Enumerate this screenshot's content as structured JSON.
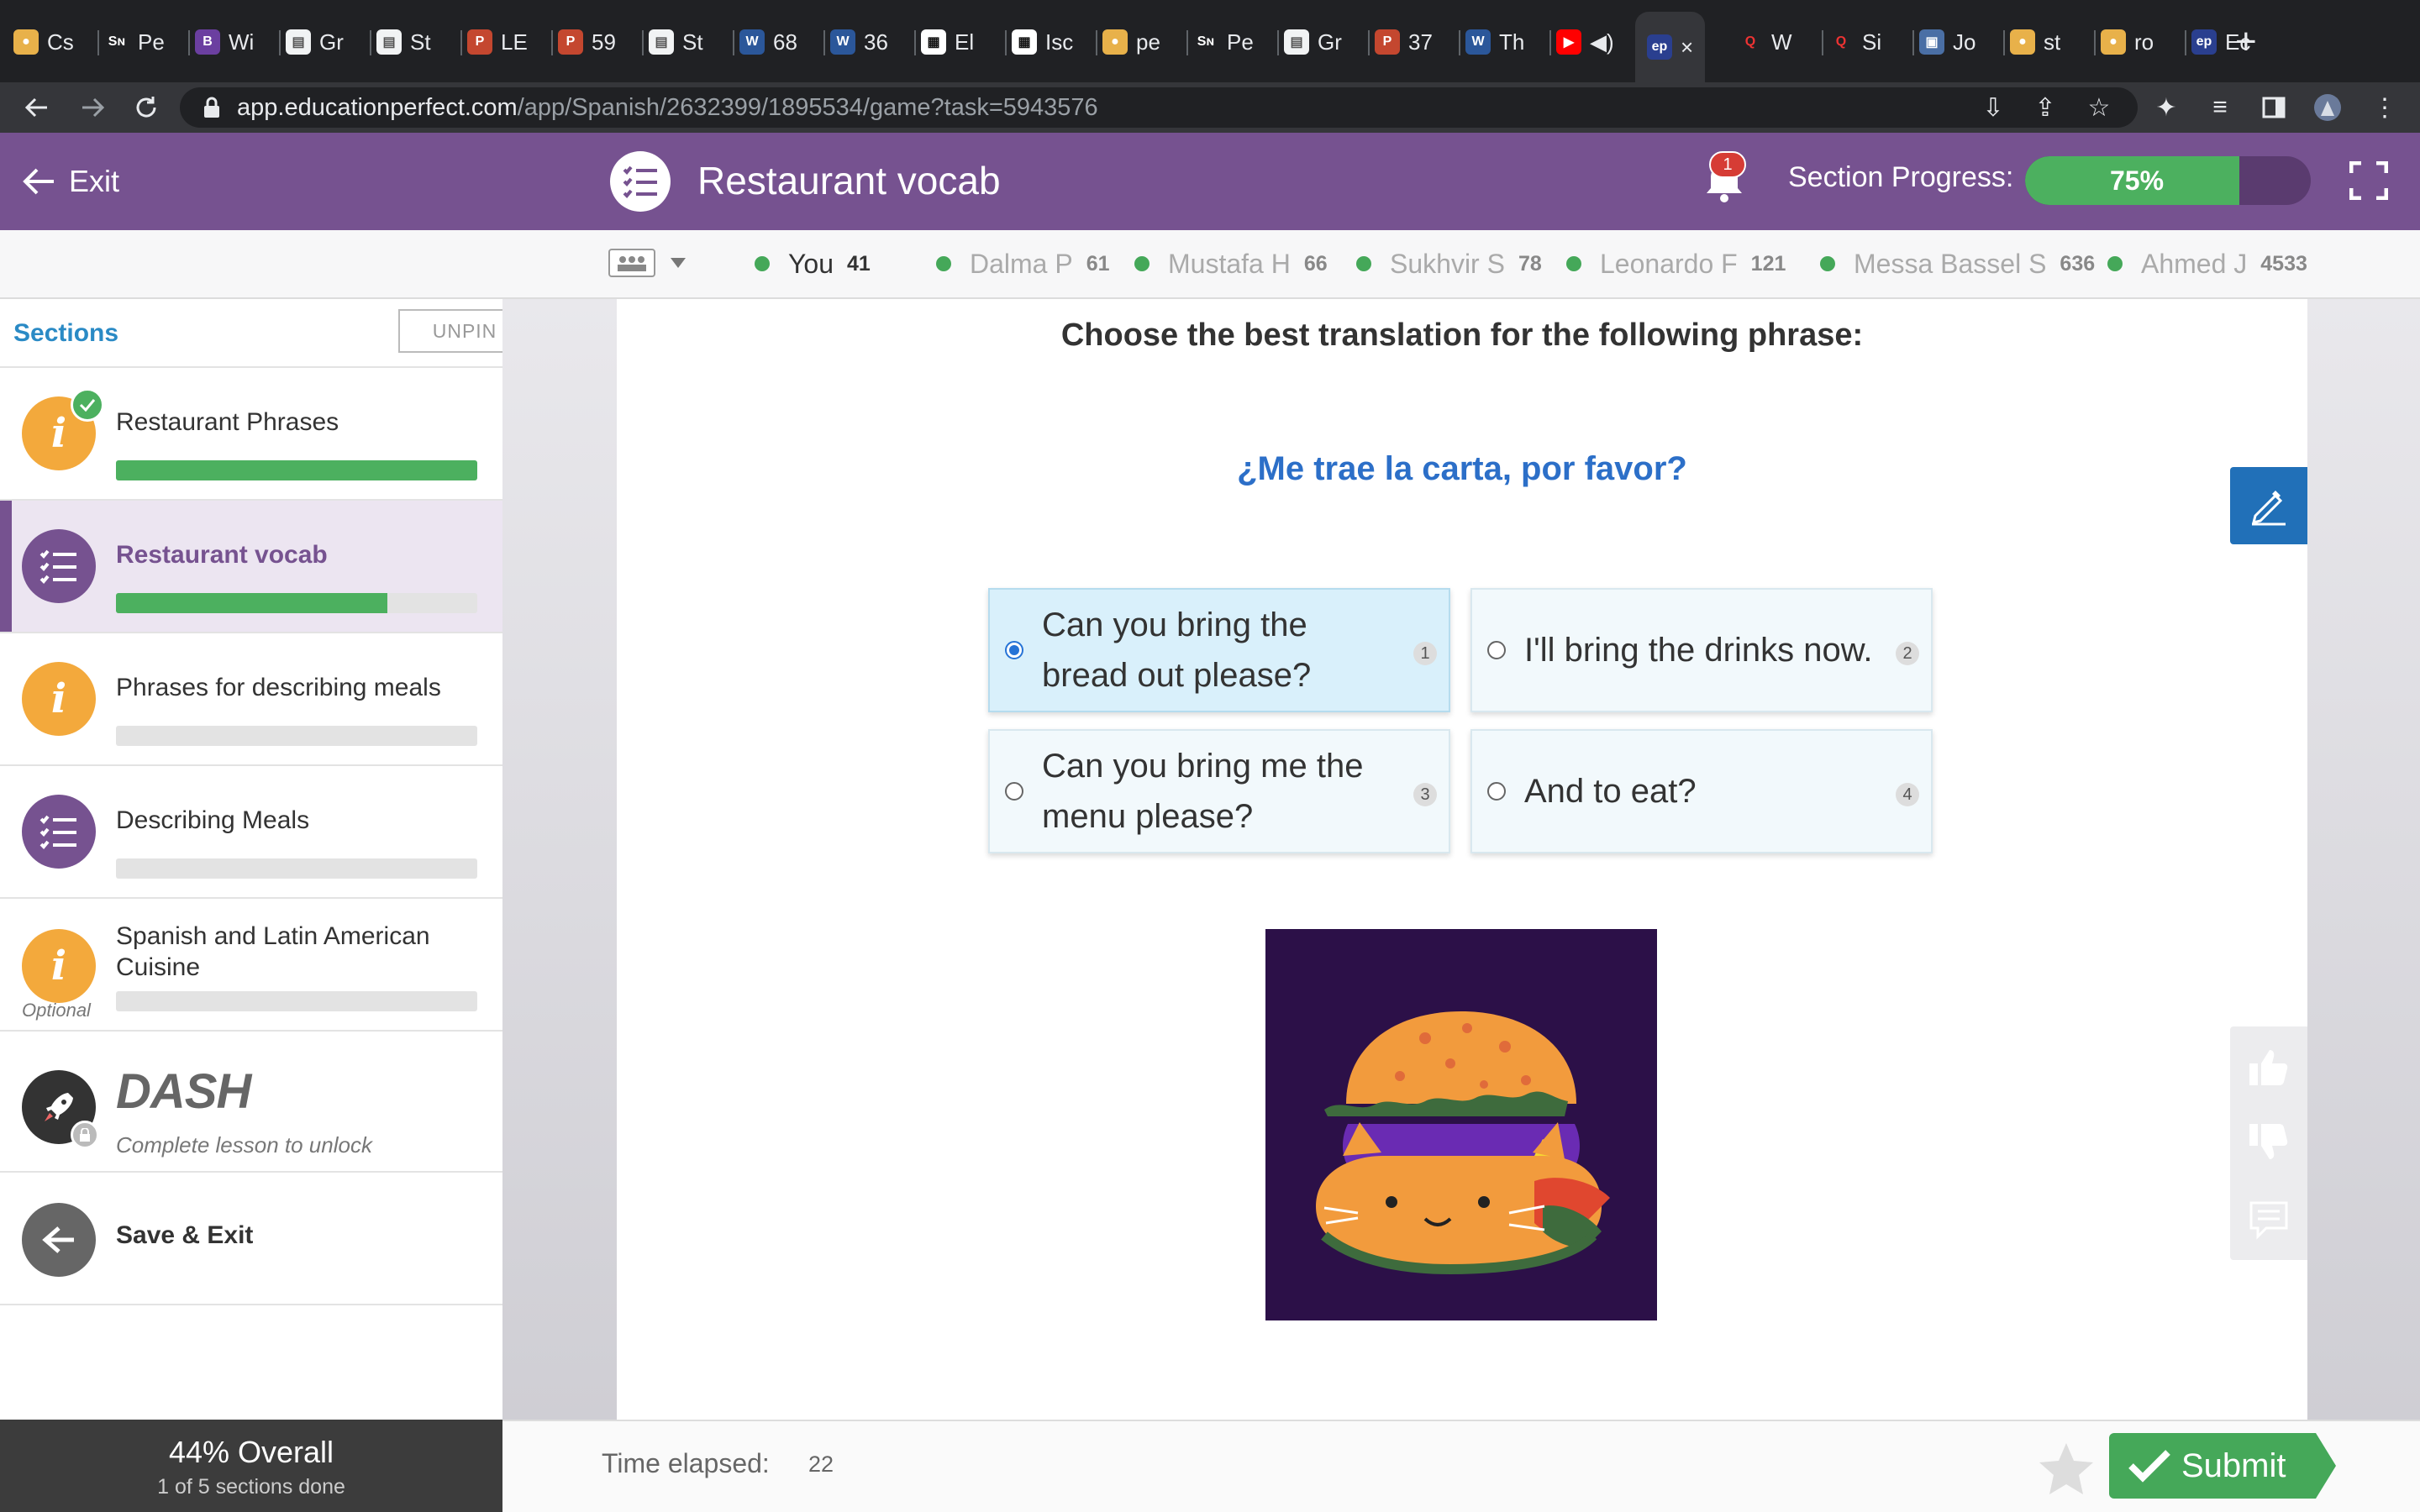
{
  "browser": {
    "tabs": [
      {
        "fav": "chrome",
        "label": "Cs"
      },
      {
        "fav": "SN",
        "label": "Pe"
      },
      {
        "fav": "B",
        "label": "Wi"
      },
      {
        "fav": "doc",
        "label": "Gr"
      },
      {
        "fav": "doc",
        "label": "St"
      },
      {
        "fav": "P",
        "label": "LE"
      },
      {
        "fav": "P",
        "label": "59"
      },
      {
        "fav": "doc",
        "label": "St"
      },
      {
        "fav": "W",
        "label": "68"
      },
      {
        "fav": "W",
        "label": "36"
      },
      {
        "fav": "grid",
        "label": "El"
      },
      {
        "fav": "grid",
        "label": "Isc"
      },
      {
        "fav": "chrome",
        "label": "pe"
      },
      {
        "fav": "SN",
        "label": "Pe"
      },
      {
        "fav": "doc",
        "label": "Gr"
      },
      {
        "fav": "P",
        "label": "37"
      },
      {
        "fav": "W",
        "label": "Th"
      },
      {
        "fav": "yt",
        "label": "◀)"
      },
      {
        "fav": "ep",
        "label": "×"
      },
      {
        "fav": "Q",
        "label": "W"
      },
      {
        "fav": "Q",
        "label": "Si"
      },
      {
        "fav": "img",
        "label": "Jo"
      },
      {
        "fav": "chrome",
        "label": "st"
      },
      {
        "fav": "chrome",
        "label": "ro"
      },
      {
        "fav": "ep",
        "label": "Ec"
      }
    ],
    "active_tab_index": 18,
    "new_tab_label": "+",
    "url_host": "app.educationperfect.com",
    "url_path": "/app/Spanish/2632399/1895534/game?task=5943576"
  },
  "header": {
    "exit_label": "Exit",
    "lesson_title": "Restaurant vocab",
    "notification_count": "1",
    "progress_label": "Section Progress:",
    "progress_value": 0.75,
    "progress_text": "75%"
  },
  "leaderboard": [
    {
      "name": "You",
      "score": "41",
      "me": true
    },
    {
      "name": "Dalma P",
      "score": "61"
    },
    {
      "name": "Mustafa H",
      "score": "66"
    },
    {
      "name": "Sukhvir S",
      "score": "78"
    },
    {
      "name": "Leonardo F",
      "score": "121"
    },
    {
      "name": "Messa Bassel S",
      "score": "636"
    },
    {
      "name": "Ahmed J",
      "score": "4533"
    }
  ],
  "sidebar": {
    "title": "Sections",
    "unpin_label": "UNPIN",
    "sections": [
      {
        "label": "Restaurant Phrases",
        "icon": "info",
        "progress": 1.0,
        "completed": true
      },
      {
        "label": "Restaurant vocab",
        "icon": "list",
        "progress": 0.75,
        "active": true
      },
      {
        "label": "Phrases for describing meals",
        "icon": "info",
        "progress": 0
      },
      {
        "label": "Describing Meals",
        "icon": "list",
        "progress": 0
      },
      {
        "label": "Spanish and Latin American Cuisine",
        "icon": "info",
        "progress": 0,
        "optional_label": "Optional"
      }
    ],
    "dash": {
      "logo": "DASH",
      "subtitle": "Complete lesson to unlock"
    },
    "save_exit_label": "Save & Exit",
    "overall": {
      "percent_label": "44% Overall",
      "sub_label": "1 of 5 sections done"
    }
  },
  "question": {
    "instruction": "Choose the best translation for the following phrase:",
    "phrase": "¿Me trae la carta, por favor?",
    "answers": [
      {
        "text": "Can you bring the bread out please?",
        "num": "1",
        "selected": true
      },
      {
        "text": "I'll bring the drinks now.",
        "num": "2",
        "selected": false
      },
      {
        "text": "Can you bring me the menu please?",
        "num": "3",
        "selected": false
      },
      {
        "text": "And to eat?",
        "num": "4",
        "selected": false
      }
    ],
    "image_icon": "burger-cat-illustration"
  },
  "footer": {
    "time_label": "Time elapsed:",
    "time_value": "22",
    "submit_label": "Submit"
  },
  "colors": {
    "brand_purple": "#765290",
    "progress_green": "#4cb05f",
    "question_blue": "#2c6fc8",
    "info_orange": "#f3a93c"
  }
}
